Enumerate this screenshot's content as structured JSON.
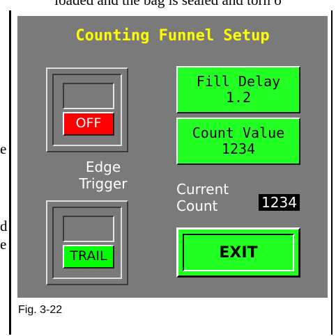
{
  "document": {
    "top_text": "loaded and the bag is sealed and torn o",
    "side_fragments": [
      "e",
      "d",
      "e"
    ],
    "figure_caption": "Fig. 3-22"
  },
  "screen": {
    "title": "Counting Funnel Setup",
    "title_color": "#ffff00",
    "background_color": "#7a7a7a",
    "toggle_top": {
      "state_label": "OFF",
      "state_color": "#ff0000"
    },
    "edge_trigger_label": [
      "Edge",
      "Trigger"
    ],
    "toggle_bottom": {
      "state_label": "TRAIL",
      "state_color": "#00ff00"
    },
    "fill_delay": {
      "label": "Fill Delay",
      "value": "1.2"
    },
    "count_value": {
      "label": "Count Value",
      "value": "1234"
    },
    "current_count": {
      "label": [
        "Current",
        "Count"
      ],
      "value": "1234"
    },
    "exit_label": "EXIT",
    "button_color": "#22ff22"
  }
}
